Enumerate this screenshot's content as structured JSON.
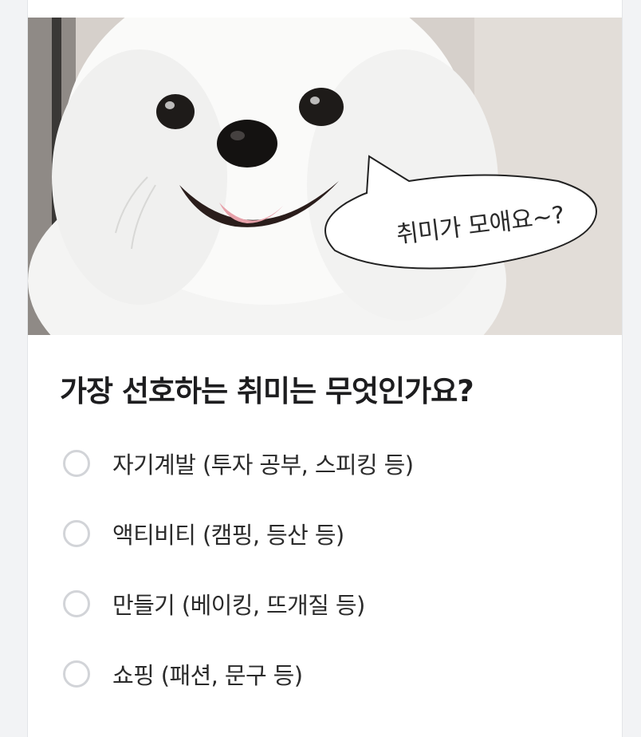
{
  "hero": {
    "speech_bubble": "취미가 모애요~?"
  },
  "question": {
    "title": "가장 선호하는 취미는 무엇인가요?"
  },
  "options": [
    {
      "label": "자기계발 (투자 공부, 스피킹 등)",
      "selected": false
    },
    {
      "label": "액티비티 (캠핑, 등산 등)",
      "selected": false
    },
    {
      "label": "만들기 (베이킹, 뜨개질 등)",
      "selected": false
    },
    {
      "label": "쇼핑 (패션, 문구 등)",
      "selected": false
    }
  ],
  "colors": {
    "radio_border": "#d2d4d8",
    "text": "#2b2b2b",
    "background": "#f2f3f5"
  }
}
